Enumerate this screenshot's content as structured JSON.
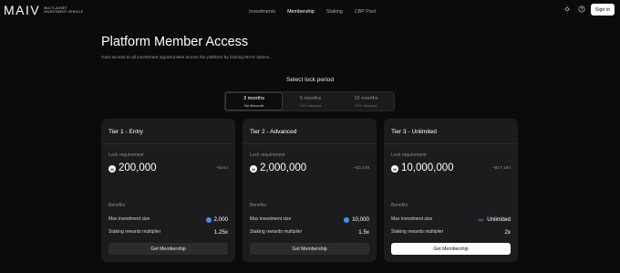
{
  "header": {
    "logo": "MAIV",
    "logo_sub_1": "MULTI-ASSET",
    "logo_sub_2": "INVESTMENT VEHICLE",
    "nav": [
      {
        "label": "Investments",
        "active": false
      },
      {
        "label": "Membership",
        "active": true
      },
      {
        "label": "Staking",
        "active": false
      },
      {
        "label": "CBP Pool",
        "active": false
      }
    ],
    "icons": [
      "sun-icon",
      "help-icon"
    ],
    "signin_label": "Sign in"
  },
  "hero": {
    "title": "Platform Member Access",
    "subtitle": "Gain access to all investment opportunities across the platform by locking MAIV tokens."
  },
  "lock": {
    "label": "Select lock period",
    "options": [
      {
        "title": "3 months",
        "sub": "No discount",
        "active": true
      },
      {
        "title": "6 months",
        "sub": "25% discount",
        "active": false
      },
      {
        "title": "12 months",
        "sub": "50% discount",
        "active": false
      }
    ]
  },
  "cards": [
    {
      "title": "Tier 1 - Entry",
      "lock_label": "Lock requirement",
      "amount": "200,000",
      "usd": "~$344",
      "benefits_label": "Benefits",
      "max_label": "Max investment size",
      "max_value": "2,000",
      "max_icon": "coin-icon",
      "mult_label": "Staking rewards multiplier",
      "mult_value": "1.25x",
      "button": "Get Membership",
      "primary": false
    },
    {
      "title": "Tier 2 - Advanced",
      "lock_label": "Lock requirement",
      "amount": "2,000,000",
      "usd": "~$3,439",
      "benefits_label": "Benefits",
      "max_label": "Max investment size",
      "max_value": "10,000",
      "max_icon": "coin-icon",
      "mult_label": "Staking rewards multiplier",
      "mult_value": "1.5x",
      "button": "Get Membership",
      "primary": false
    },
    {
      "title": "Tier 3 - Unlimited",
      "lock_label": "Lock requirement",
      "amount": "10,000,000",
      "usd": "~$17,194",
      "benefits_label": "Benefits",
      "max_label": "Max investment size",
      "max_value": "Unlimited",
      "max_icon": "infinity-icon",
      "mult_label": "Staking rewards multiplier",
      "mult_value": "2x",
      "button": "Get Membership",
      "primary": true
    }
  ],
  "colors": {
    "background": "#0b0b0c",
    "card": "#1c1c1e",
    "accent_blue": "#4a8fe7",
    "primary_button": "#ffffff"
  }
}
